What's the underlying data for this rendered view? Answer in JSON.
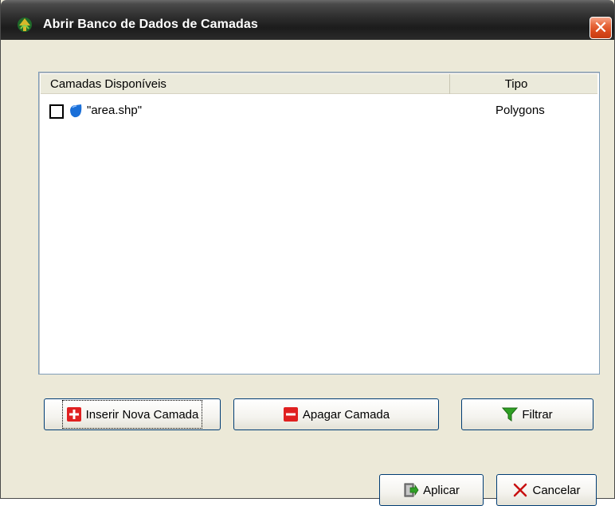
{
  "window": {
    "title": "Abrir Banco de Dados de Camadas",
    "close_symbol": "✕"
  },
  "list": {
    "columns": [
      "Camadas Disponíveis",
      "Tipo"
    ],
    "rows": [
      {
        "name": "\"area.shp\"",
        "type": "Polygons",
        "checked": false,
        "icon": "polygon-layer-icon"
      }
    ]
  },
  "buttons": {
    "insert_label": "Inserir Nova Camada",
    "delete_label": "Apagar Camada",
    "filter_label": "Filtrar",
    "apply_label": "Aplicar",
    "cancel_label": "Cancelar"
  },
  "colors": {
    "titlebar": "#2c2c2c",
    "close_button": "#d8471a",
    "add_icon": "#e02020",
    "remove_icon": "#e02020",
    "filter_icon": "#2fa024",
    "polygon_icon": "#1a6fd8",
    "cancel_icon": "#c81010"
  }
}
